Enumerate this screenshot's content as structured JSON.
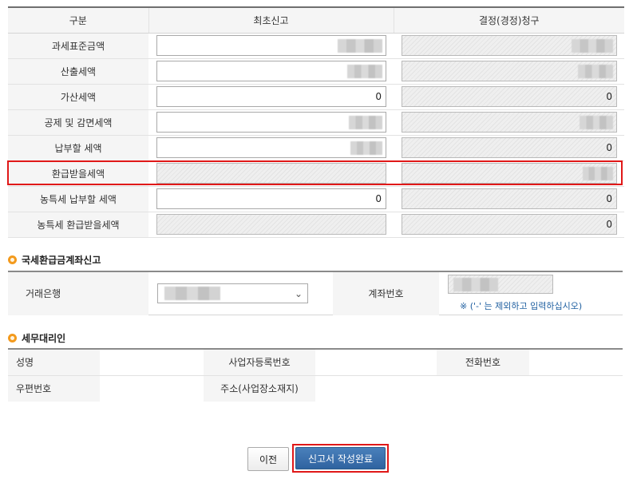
{
  "tax_table": {
    "headers": {
      "category": "구분",
      "initial": "최초신고",
      "correction": "결정(경정)청구"
    },
    "rows": [
      {
        "label": "과세표준금액",
        "initial": "",
        "correction": ""
      },
      {
        "label": "산출세액",
        "initial": "",
        "correction": ""
      },
      {
        "label": "가산세액",
        "initial": "0",
        "correction": "0"
      },
      {
        "label": "공제 및 감면세액",
        "initial": "",
        "correction": ""
      },
      {
        "label": "납부할 세액",
        "initial": "",
        "correction": "0"
      },
      {
        "label": "환급받을세액",
        "initial": "",
        "correction": ""
      },
      {
        "label": "농특세 납부할 세액",
        "initial": "0",
        "correction": "0"
      },
      {
        "label": "농특세 환급받을세액",
        "initial": "",
        "correction": "0"
      }
    ]
  },
  "refund_account": {
    "title": "국세환급금계좌신고",
    "bank_label": "거래은행",
    "account_label": "계좌번호",
    "note": "※ ('-' 는 제외하고 입력하십시오)"
  },
  "tax_agent": {
    "title": "세무대리인",
    "name_label": "성명",
    "bizno_label": "사업자등록번호",
    "phone_label": "전화번호",
    "zip_label": "우편번호",
    "address_label": "주소(사업장소재지)"
  },
  "buttons": {
    "prev": "이전",
    "complete": "신고서 작성완료"
  },
  "colors": {
    "highlight": "#e01818",
    "primary_button": "#3a6ea9",
    "note_text": "#1f5fa0",
    "bullet": "#f39a1d"
  }
}
